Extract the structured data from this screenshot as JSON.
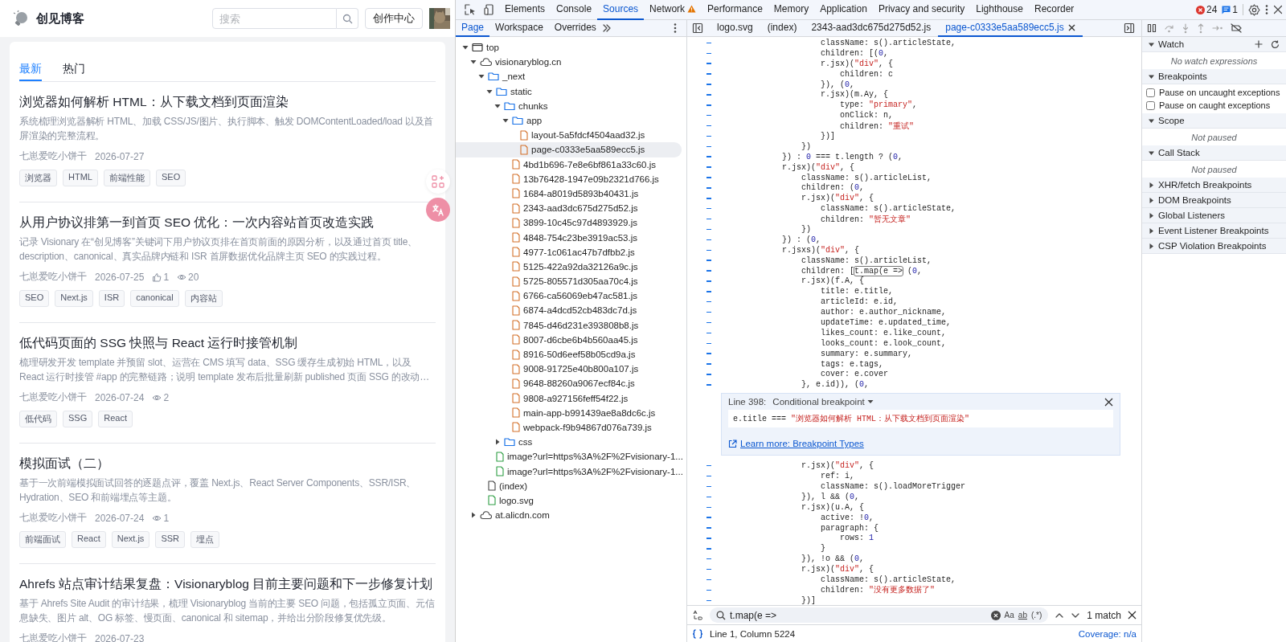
{
  "blog": {
    "site_title": "创见博客",
    "search": {
      "placeholder": "搜索"
    },
    "create_button": "创作中心",
    "tabs": [
      {
        "label": "最新",
        "selected": true
      },
      {
        "label": "热门",
        "selected": false
      }
    ],
    "articles": [
      {
        "title": "浏览器如何解析 HTML：从下载文档到页面渲染",
        "summary": "系统梳理浏览器解析 HTML、加载 CSS/JS/图片、执行脚本、触发 DOMContentLoaded/load 以及首屏渲染的完整流程。",
        "author": "七崽爱吃小饼干",
        "date": "2026-07-27",
        "tags": [
          "浏览器",
          "HTML",
          "前端性能",
          "SEO"
        ]
      },
      {
        "title": "从用户协议排第一到首页 SEO 优化：一次内容站首页改造实践",
        "summary": "记录 Visionary 在“创见博客”关键词下用户协议页排在首页前面的原因分析，以及通过首页 title、description、canonical、真实品牌内链和 ISR 首屏数据优化品牌主页 SEO 的实践过程。",
        "author": "七崽爱吃小饼干",
        "date": "2026-07-25",
        "likes": "1",
        "views": "20",
        "tags": [
          "SEO",
          "Next.js",
          "ISR",
          "canonical",
          "内容站"
        ]
      },
      {
        "title": "低代码页面的 SSG 快照与 React 运行时接管机制",
        "summary": "梳理研发开发 template 并预留 slot、运营在 CMS 填写 data、SSG 缓存生成初始 HTML，以及 React 运行时接管 #app 的完整链路；说明 template 发布后批量刷新 published 页面 SSG 的改动…",
        "author": "七崽爱吃小饼干",
        "date": "2026-07-24",
        "views": "2",
        "tags": [
          "低代码",
          "SSG",
          "React"
        ]
      },
      {
        "title": "模拟面试（二）",
        "summary": "基于一次前端模拟面试回答的逐题点评，覆盖 Next.js、React Server Components、SSR/ISR、Hydration、SEO 和前端埋点等主题。",
        "author": "七崽爱吃小饼干",
        "date": "2026-07-24",
        "views": "1",
        "tags": [
          "前端面试",
          "React",
          "Next.js",
          "SSR",
          "埋点"
        ]
      },
      {
        "title": "Ahrefs 站点审计结果复盘：Visionaryblog 目前主要问题和下一步修复计划",
        "summary": "基于 Ahrefs Site Audit 的审计结果，梳理 Visionaryblog 当前的主要 SEO 问题，包括孤立页面、元信息缺失、图片 alt、OG 标签、慢页面、canonical 和 sitemap，并给出分阶段修复优先级。",
        "author": "七崽爱吃小饼干",
        "date": "2026-07-23"
      }
    ]
  },
  "devtools": {
    "tabs": [
      {
        "label": "Elements",
        "selected": false
      },
      {
        "label": "Console",
        "selected": false
      },
      {
        "label": "Sources",
        "selected": true
      },
      {
        "label": "Network",
        "selected": false,
        "warning": true
      },
      {
        "label": "Performance",
        "selected": false
      },
      {
        "label": "Memory",
        "selected": false
      },
      {
        "label": "Application",
        "selected": false
      },
      {
        "label": "Privacy and security",
        "selected": false
      },
      {
        "label": "Lighthouse",
        "selected": false
      },
      {
        "label": "Recorder",
        "selected": false
      }
    ],
    "errors": "24",
    "messages": "1",
    "navigator": {
      "tabs": [
        {
          "label": "Page",
          "selected": true
        },
        {
          "label": "Workspace",
          "selected": false
        },
        {
          "label": "Overrides",
          "selected": false
        }
      ],
      "tree": [
        {
          "name": "top",
          "kind": "frame",
          "expanded": true,
          "children": [
            {
              "name": "visionaryblog.cn",
              "kind": "domain",
              "expanded": true,
              "children": [
                {
                  "name": "_next",
                  "kind": "folder",
                  "expanded": true,
                  "children": [
                    {
                      "name": "static",
                      "kind": "folder",
                      "expanded": true,
                      "children": [
                        {
                          "name": "chunks",
                          "kind": "folder",
                          "expanded": true,
                          "children": [
                            {
                              "name": "app",
                              "kind": "folder",
                              "expanded": true,
                              "children": [
                                {
                                  "name": "layout-5a5fdcf4504aad32.js",
                                  "kind": "script",
                                  "selected": false
                                },
                                {
                                  "name": "page-c0333e5aa589ecc5.js",
                                  "kind": "script",
                                  "selected": true
                                }
                              ]
                            },
                            {
                              "name": "4bd1b696-7e8e6bf861a33c60.js",
                              "kind": "script",
                              "selected": false
                            },
                            {
                              "name": "13b76428-1947e09b2321d766.js",
                              "kind": "script",
                              "selected": false
                            },
                            {
                              "name": "1684-a8019d5893b40431.js",
                              "kind": "script",
                              "selected": false
                            },
                            {
                              "name": "2343-aad3dc675d275d52.js",
                              "kind": "script",
                              "selected": false
                            },
                            {
                              "name": "3899-10c45c97d4893929.js",
                              "kind": "script",
                              "selected": false
                            },
                            {
                              "name": "4848-754c23be3919ac53.js",
                              "kind": "script",
                              "selected": false
                            },
                            {
                              "name": "4977-1c061ac47b7dfbb2.js",
                              "kind": "script",
                              "selected": false
                            },
                            {
                              "name": "5125-422a92da32126a9c.js",
                              "kind": "script",
                              "selected": false
                            },
                            {
                              "name": "5725-805571d305aa70c4.js",
                              "kind": "script",
                              "selected": false
                            },
                            {
                              "name": "6766-ca56069eb47ac581.js",
                              "kind": "script",
                              "selected": false
                            },
                            {
                              "name": "6874-a4dcd52cb483dc7d.js",
                              "kind": "script",
                              "selected": false
                            },
                            {
                              "name": "7845-d46d231e393808b8.js",
                              "kind": "script",
                              "selected": false
                            },
                            {
                              "name": "8007-d6cbe6b4b560aa45.js",
                              "kind": "script",
                              "selected": false
                            },
                            {
                              "name": "8916-50d6eef58b05cd9a.js",
                              "kind": "script",
                              "selected": false
                            },
                            {
                              "name": "9008-91725e40b800a107.js",
                              "kind": "script",
                              "selected": false
                            },
                            {
                              "name": "9648-88260a9067ecf84c.js",
                              "kind": "script",
                              "selected": false
                            },
                            {
                              "name": "9808-a927156feff54f22.js",
                              "kind": "script",
                              "selected": false
                            },
                            {
                              "name": "main-app-b991439ae8a8dc6c.js",
                              "kind": "script",
                              "selected": false
                            },
                            {
                              "name": "webpack-f9b94867d076a739.js",
                              "kind": "script",
                              "selected": false
                            }
                          ]
                        },
                        {
                          "name": "css",
                          "kind": "folder",
                          "expanded": false
                        }
                      ]
                    },
                    {
                      "name": "image?url=https%3A%2F%2Fvisionary-1...",
                      "selected": false
                    },
                    {
                      "name": "image?url=https%3A%2F%2Fvisionary-1...",
                      "selected": false
                    }
                  ]
                },
                {
                  "name": "(index)",
                  "kind": "document",
                  "selected": false
                },
                {
                  "name": "logo.svg",
                  "selected": false
                }
              ]
            },
            {
              "name": "at.alicdn.com",
              "kind": "domain",
              "expanded": false
            }
          ]
        }
      ]
    },
    "editor": {
      "tabs": [
        {
          "label": "logo.svg",
          "selected": false
        },
        {
          "label": "(index)",
          "selected": false
        },
        {
          "label": "2343-aad3dc675d275d52.js",
          "selected": false
        },
        {
          "label": "page-c0333e5aa589ecc5.js",
          "selected": true
        }
      ],
      "lines_above": [
        "            className: s().articleState,",
        "            children: [(0,",
        "            r.jsx)(\"div\", {",
        "                children: c",
        "            }), (0,",
        "            r.jsx)(m.Ay, {",
        "                type: \"primary\",",
        "                onClick: n,",
        "                children: \"重试\"",
        "            })]",
        "        })",
        "    }) : 0 === t.length ? (0,",
        "    r.jsx)(\"div\", {",
        "        className: s().articleList,",
        "        children: (0,",
        "        r.jsx)(\"div\", {",
        "            className: s().articleState,",
        "            children: \"暂无文章\"",
        "        })",
        "    }) : (0,",
        "    r.jsxs)(\"div\", {",
        "        className: s().articleList,",
        {
          "before": "        children: [",
          "match": "t.map(e =>",
          "after": " (0,"
        },
        "        r.jsx)(f.A, {",
        "            title: e.title,",
        "            articleId: e.id,",
        "            author: e.author_nickname,",
        "            updateTime: e.updated_time,",
        "            likes_count: e.like_count,",
        "            looks_count: e.look_count,",
        "            summary: e.summary,",
        "            tags: e.tags,",
        "            cover: e.cover",
        "        }, e.id)), (0,"
      ],
      "breakpoint_editor": {
        "line": "Line 398:",
        "type": "Conditional breakpoint",
        "condition": "e.title === \"浏览器如何解析 HTML：从下载文档到页面渲染\"",
        "link": "Learn more: Breakpoint Types"
      },
      "lines_below": [
        "        r.jsx)(\"div\", {",
        "            ref: i,",
        "            className: s().loadMoreTrigger",
        "        }), l && (0,",
        "        r.jsx)(u.A, {",
        "            active: !0,",
        "            paragraph: {",
        "                rows: 1",
        "            }",
        "        }), !o && (0,",
        "        r.jsx)(\"div\", {",
        "            className: s().articleState,",
        "            children: \"没有更多数据了\"",
        "        })]"
      ],
      "search": {
        "value": "t.map(e =>",
        "toggles": [
          "Aa",
          "ab",
          "(.*)"
        ],
        "result": "1 match"
      },
      "status": {
        "position": "Line 1, Column 5224",
        "coverage": "Coverage: n/a"
      }
    },
    "debugger": {
      "sections": [
        {
          "title": "Watch",
          "expanded": true,
          "kind": "watch",
          "message": "No watch expressions"
        },
        {
          "title": "Breakpoints",
          "expanded": true,
          "kind": "options",
          "options": [
            {
              "label": "Pause on uncaught exceptions",
              "checked": false
            },
            {
              "label": "Pause on caught exceptions",
              "checked": false
            }
          ]
        },
        {
          "title": "Scope",
          "expanded": true,
          "kind": "message",
          "message": "Not paused"
        },
        {
          "title": "Call Stack",
          "expanded": true,
          "kind": "message",
          "message": "Not paused"
        },
        {
          "title": "XHR/fetch Breakpoints",
          "expanded": false,
          "kind": "message"
        },
        {
          "title": "DOM Breakpoints",
          "expanded": false,
          "kind": "message"
        },
        {
          "title": "Global Listeners",
          "expanded": false,
          "kind": "message"
        },
        {
          "title": "Event Listener Breakpoints",
          "expanded": false,
          "kind": "message"
        },
        {
          "title": "CSP Violation Breakpoints",
          "expanded": false,
          "kind": "message"
        }
      ]
    }
  }
}
